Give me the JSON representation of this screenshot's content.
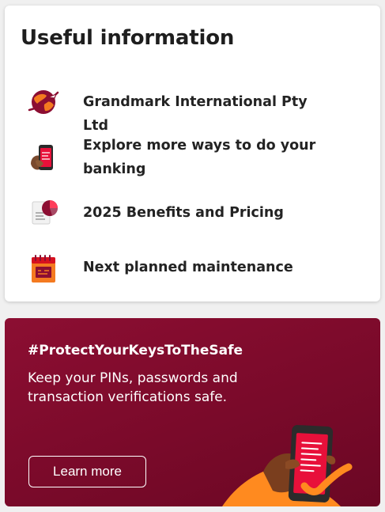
{
  "useful_info": {
    "title": "Useful information",
    "items": [
      {
        "label": "Grandmark International Pty Ltd",
        "icon": "globe-plane-icon"
      },
      {
        "label": "Explore more ways to do your banking",
        "icon": "phone-in-hand-icon"
      },
      {
        "label": "2025 Benefits and Pricing",
        "icon": "pie-chart-document-icon"
      },
      {
        "label": "Next planned maintenance",
        "icon": "calendar-icon"
      }
    ]
  },
  "promo": {
    "hashtag": "#ProtectYourKeysToTheSafe",
    "body": "Keep your PINs, passwords and transaction verifications safe.",
    "button_label": "Learn more",
    "illustration": "hand-holding-phone-checkmark-icon"
  },
  "colors": {
    "brand_red": "#8c0e32",
    "accent_orange": "#ff7a1a",
    "text_dark": "#1e1e1e"
  }
}
